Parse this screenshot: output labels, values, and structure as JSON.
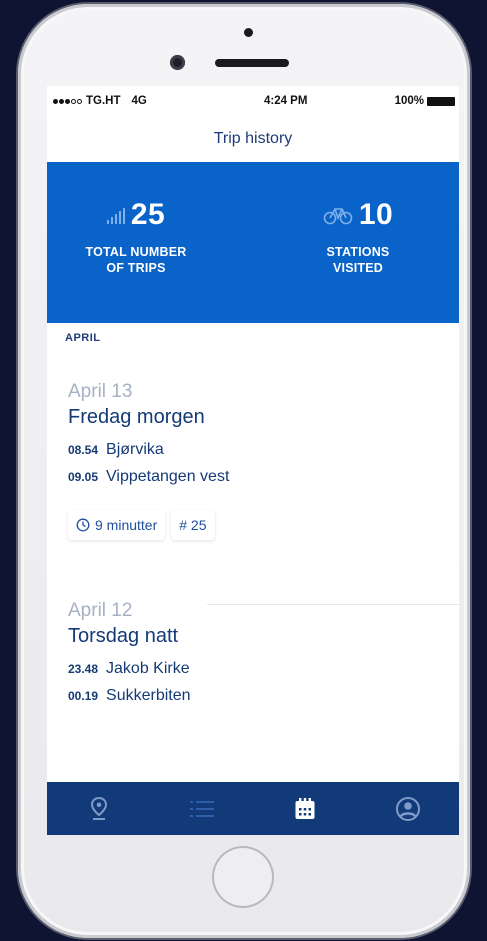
{
  "status_bar": {
    "carrier": "TG.HT",
    "network": "4G",
    "time": "4:24 PM",
    "battery": "100%"
  },
  "nav": {
    "title": "Trip history"
  },
  "stats": {
    "trips": {
      "value": "25",
      "label_line1": "TOTAL NUMBER",
      "label_line2": "OF TRIPS",
      "icon": "signal-bars-icon"
    },
    "stations": {
      "value": "10",
      "label_line1": "STATIONS",
      "label_line2": "VISITED",
      "icon": "bicycle-icon"
    }
  },
  "section": {
    "month": "APRIL"
  },
  "trips": [
    {
      "date": "April 13",
      "name": "Fredag morgen",
      "start_time": "08.54",
      "start_station": "Bjørvika",
      "end_time": "09.05",
      "end_station": "Vippetangen vest",
      "duration": "9 minutter",
      "trip_number": "# 25"
    },
    {
      "date": "April 12",
      "name": "Torsdag natt",
      "start_time": "23.48",
      "start_station": "Jakob Kirke",
      "end_time": "00.19",
      "end_station": "Sukkerbiten"
    }
  ],
  "tabbar": {
    "items": [
      {
        "icon": "map-pin-icon",
        "active": false
      },
      {
        "icon": "list-icon",
        "active": false
      },
      {
        "icon": "calendar-icon",
        "active": true
      },
      {
        "icon": "profile-icon",
        "active": false
      }
    ]
  },
  "colors": {
    "accent": "#0a63c8",
    "navy": "#123a79",
    "text_primary": "#143a76",
    "text_muted": "#a7b1c4",
    "background": "#0f1433"
  }
}
